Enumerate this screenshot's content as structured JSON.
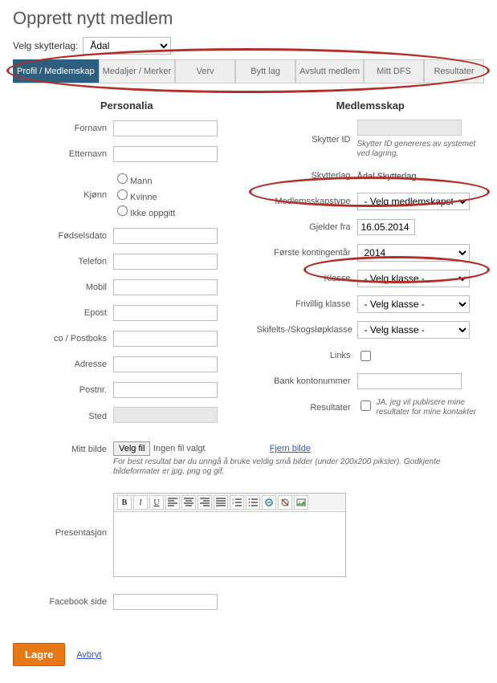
{
  "page_title": "Opprett nytt medlem",
  "top": {
    "velg_skytterlag_label": "Velg skytterlag:",
    "skytterlag_value": "Ådal"
  },
  "tabs": [
    {
      "label": "Profil / Medlemskap",
      "active": true
    },
    {
      "label": "Medaljer / Merker",
      "active": false
    },
    {
      "label": "Verv",
      "active": false
    },
    {
      "label": "Bytt lag",
      "active": false
    },
    {
      "label": "Avslutt medlem",
      "active": false
    },
    {
      "label": "Mitt DFS",
      "active": false
    },
    {
      "label": "Resultater",
      "active": false
    }
  ],
  "personalia": {
    "heading": "Personalia",
    "fornavn_label": "Fornavn",
    "etternavn_label": "Etternavn",
    "kjonn_label": "Kjønn",
    "kjonn_options": {
      "mann": "Mann",
      "kvinne": "Kvinne",
      "ikke": "Ikke oppgitt"
    },
    "fodselsdato_label": "Fødselsdato",
    "telefon_label": "Telefon",
    "mobil_label": "Mobil",
    "epost_label": "Epost",
    "co_label": "co / Postboks",
    "adresse_label": "Adresse",
    "postnr_label": "Postnr.",
    "sted_label": "Sted"
  },
  "medlemsskap": {
    "heading": "Medlemsskap",
    "skytter_id_label": "Skytter ID",
    "skytter_id_hint": "Skytter ID genereres av systemet ved lagring.",
    "skytterlag_label": "Skytterlag",
    "skytterlag_value": "Ådal Skytterlag",
    "medlemsskapstype_label": "Medlemsskapstype",
    "medlemsskapstype_value": "- Velg medlemskapstype",
    "gjelder_fra_label": "Gjelder fra",
    "gjelder_fra_value": "16.05.2014",
    "forste_kontingentar_label": "Første kontingentår",
    "forste_kontingentar_value": "2014",
    "klasse_label": "Klasse",
    "klasse_value": "- Velg klasse -",
    "frivillig_klasse_label": "Frivillig klasse",
    "frivillig_klasse_value": "- Velg klasse -",
    "skifelts_label": "Skifelts-/Skogsløpklasse",
    "skifelts_value": "- Velg klasse -",
    "links_label": "Links",
    "bank_label": "Bank kontonummer",
    "resultater_label": "Resultater",
    "resultater_chk": "JA, jeg vil publisere mine resultater for mine kontakter"
  },
  "bilde": {
    "mitt_bilde_label": "Mitt bilde",
    "velg_fil": "Velg fil",
    "ingen_fil": "Ingen fil valgt",
    "fjern_bilde": "Fjern bilde",
    "hint": "For best resultat bør du unngå å bruke veldig små bilder (under 200x200 piksler). Godkjente bildeformater er jpg, png og gif."
  },
  "presentasjon_label": "Presentasjon",
  "facebook_label": "Facebook side",
  "buttons": {
    "lagre": "Lagre",
    "avbryt": "Avbryt"
  }
}
